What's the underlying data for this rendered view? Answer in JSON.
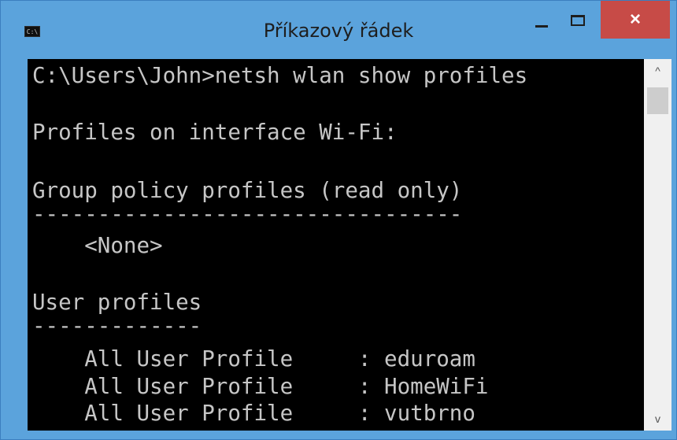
{
  "window": {
    "title": "Příkazový řádek",
    "close_label": "×",
    "app_icon_text": "C:\\",
    "icons": {
      "app": "console-icon",
      "minimize": "minimize-icon",
      "maximize": "maximize-icon",
      "close": "close-icon"
    }
  },
  "console": {
    "lines": [
      "C:\\Users\\John>netsh wlan show profiles",
      "",
      "Profiles on interface Wi-Fi:",
      "",
      "Group policy profiles (read only)",
      "---------------------------------",
      "    <None>",
      "",
      "User profiles",
      "-------------",
      "    All User Profile     : eduroam",
      "    All User Profile     : HomeWiFi",
      "    All User Profile     : vutbrno"
    ]
  },
  "scrollbar": {
    "up_arrow": "^",
    "down_arrow": "v"
  },
  "colors": {
    "titlebar": "#5ba3dc",
    "close": "#c74b47",
    "console_bg": "#000000",
    "console_text": "#c6c6c6"
  }
}
